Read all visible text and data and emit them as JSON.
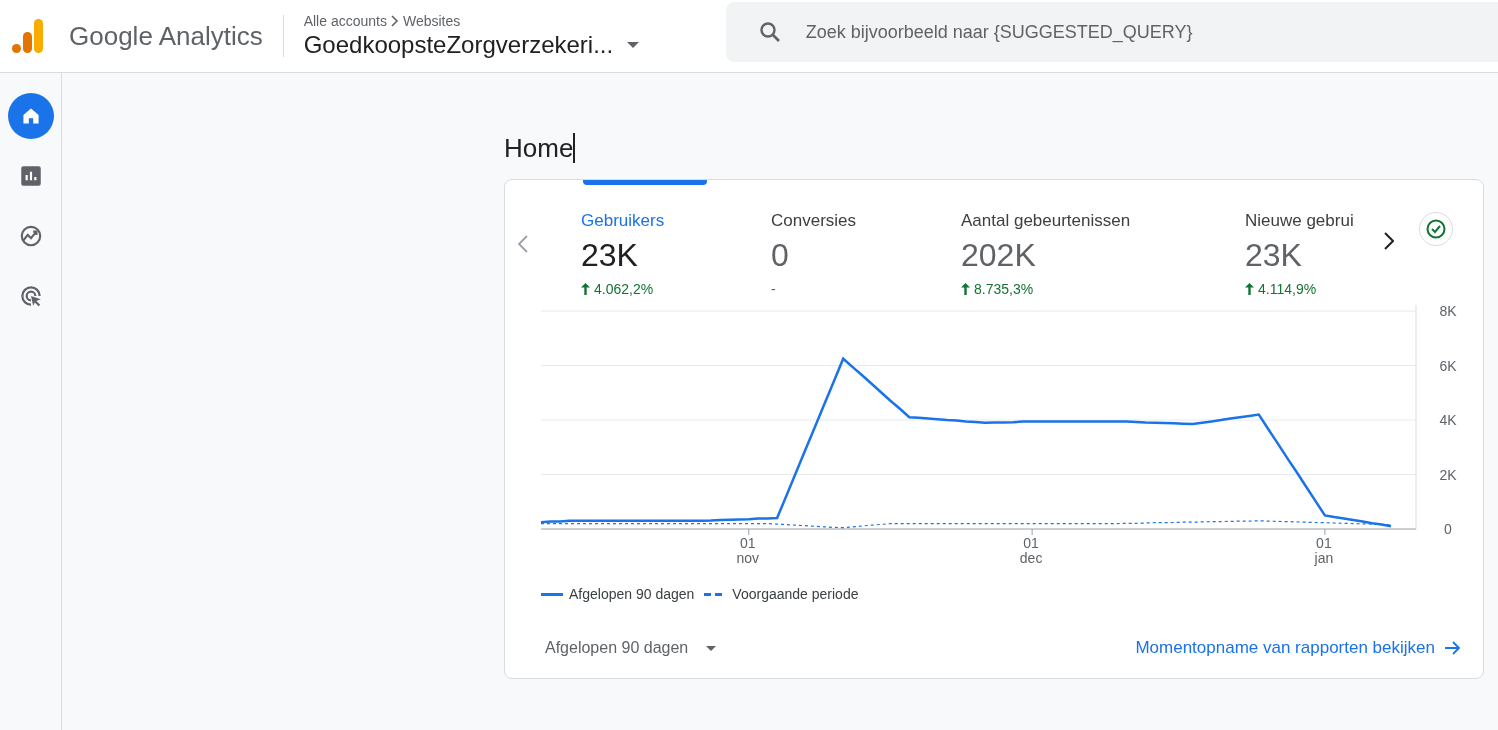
{
  "header": {
    "product": "Google Analytics",
    "breadcrumb": [
      "Alle accounts",
      "Websites"
    ],
    "property": "GoedkoopsteZorgverzekeri...",
    "search": {
      "placeholder": "Zoek bijvoorbeeld naar {SUGGESTED_QUERY}"
    }
  },
  "sidebar": {
    "items": [
      {
        "selected": true
      },
      {
        "selected": false
      },
      {
        "selected": false
      },
      {
        "selected": false
      }
    ]
  },
  "page": {
    "title": "Home"
  },
  "card": {
    "metrics": [
      {
        "label": "Gebruikers",
        "value": "23K",
        "kind": "up",
        "change": "4.062,2%",
        "selected": true
      },
      {
        "label": "Conversies",
        "value": "0",
        "kind": "none",
        "change": "-",
        "selected": false
      },
      {
        "label": "Aantal gebeurtenissen",
        "value": "202K",
        "kind": "up",
        "change": "8.735,3%",
        "selected": false
      },
      {
        "label": "Nieuwe gebrui",
        "value": "23K",
        "kind": "up",
        "change": "4.114,9%",
        "selected": false
      }
    ],
    "chart_data": {
      "type": "line",
      "categories": [
        null,
        null,
        null,
        null,
        null,
        null,
        null,
        null,
        null,
        null,
        null,
        null,
        null,
        null,
        null,
        null,
        null,
        null,
        null,
        null,
        null,
        null,
        "01 nov",
        null,
        null,
        null,
        null,
        null,
        null,
        null,
        null,
        null,
        null,
        null,
        null,
        null,
        null,
        null,
        null,
        null,
        null,
        null,
        null,
        null,
        null,
        null,
        null,
        null,
        null,
        null,
        null,
        null,
        "01 dec",
        null,
        null,
        null,
        null,
        null,
        null,
        null,
        null,
        null,
        null,
        null,
        null,
        null,
        null,
        null,
        null,
        null,
        null,
        null,
        null,
        null,
        null,
        null,
        null,
        null,
        null,
        null,
        null,
        null,
        null,
        "01 jan",
        null,
        null,
        null,
        null,
        null,
        null,
        null
      ],
      "ylim": [
        0,
        8000
      ],
      "grid": true,
      "yticks": [
        {
          "value": 0,
          "label": "0"
        },
        {
          "value": 2000,
          "label": "2K"
        },
        {
          "value": 4000,
          "label": "4K"
        },
        {
          "value": 6000,
          "label": "6K"
        },
        {
          "value": 8000,
          "label": "8K"
        }
      ],
      "series": [
        {
          "name": "Afgelopen 90 dagen",
          "color": "#1a73e8",
          "line_style": "solid",
          "values": [
            250,
            270,
            280,
            300,
            300,
            300,
            300,
            300,
            300,
            300,
            300,
            300,
            300,
            300,
            300,
            300,
            300,
            300,
            310,
            330,
            340,
            350,
            360,
            380,
            390,
            400,
            1240,
            2070,
            2910,
            3740,
            4580,
            5410,
            6250,
            5940,
            5640,
            5330,
            5020,
            4710,
            4410,
            4100,
            4080,
            4050,
            4030,
            4000,
            3980,
            3950,
            3930,
            3900,
            3910,
            3910,
            3920,
            3940,
            3940,
            3940,
            3950,
            3950,
            3950,
            3950,
            3950,
            3950,
            3950,
            3950,
            3940,
            3930,
            3910,
            3900,
            3890,
            3880,
            3860,
            3850,
            3900,
            3950,
            4000,
            4050,
            4100,
            4150,
            4200,
            3670,
            3140,
            2610,
            2090,
            1560,
            1030,
            500,
            440,
            390,
            330,
            270,
            210,
            160,
            100
          ]
        },
        {
          "name": "Voorgaande periode",
          "color": "#1a73e8",
          "line_style": "dashed",
          "values": [
            200,
            200,
            200,
            200,
            200,
            200,
            200,
            200,
            200,
            200,
            200,
            200,
            200,
            200,
            200,
            200,
            200,
            200,
            200,
            200,
            200,
            200,
            200,
            200,
            200,
            180,
            160,
            140,
            120,
            100,
            80,
            60,
            50,
            80,
            110,
            140,
            170,
            200,
            200,
            200,
            200,
            200,
            200,
            200,
            200,
            200,
            200,
            200,
            200,
            200,
            200,
            200,
            200,
            200,
            200,
            200,
            200,
            200,
            200,
            200,
            200,
            200,
            210,
            210,
            220,
            230,
            230,
            240,
            250,
            250,
            260,
            270,
            270,
            280,
            290,
            290,
            300,
            290,
            280,
            270,
            260,
            250,
            240,
            230,
            220,
            210,
            200,
            190,
            180,
            170,
            150
          ]
        }
      ]
    },
    "range": "Afgelopen 90 dagen",
    "link": "Momentopname van rapporten bekijken"
  }
}
